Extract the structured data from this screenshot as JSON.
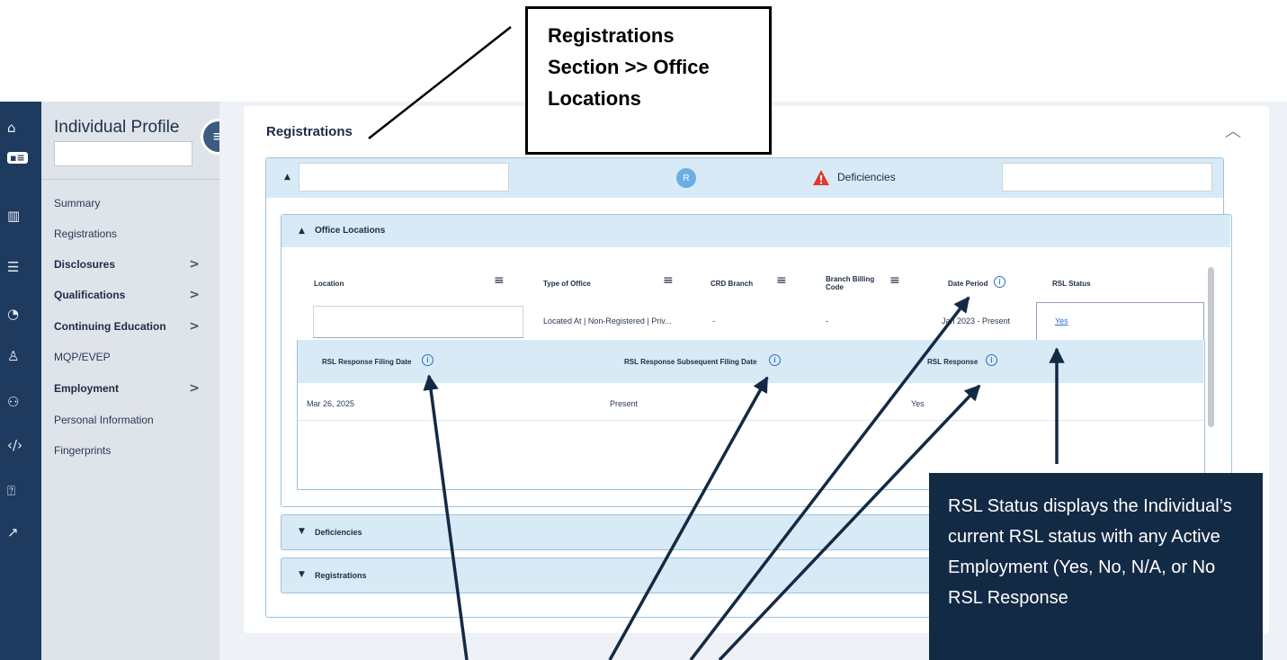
{
  "rail": {
    "icons": [
      "home-icon",
      "profile-card-icon",
      "library-icon",
      "checklist-icon",
      "analytics-icon",
      "user-settings-icon",
      "group-icon",
      "code-icon",
      "help-icon",
      "external-link-icon"
    ]
  },
  "sidenav": {
    "title": "Individual Profile",
    "items": [
      {
        "label": "Summary",
        "bold": false,
        "chevron": ""
      },
      {
        "label": "Registrations",
        "bold": false,
        "chevron": ""
      },
      {
        "label": "Disclosures",
        "bold": true,
        "chevron": ">"
      },
      {
        "label": "Qualifications",
        "bold": true,
        "chevron": ">"
      },
      {
        "label": "Continuing Education",
        "bold": true,
        "chevron": ">"
      },
      {
        "label": "MQP/EVEP",
        "bold": false,
        "chevron": ""
      },
      {
        "label": "Employment",
        "bold": true,
        "chevron": ">"
      },
      {
        "label": "Personal Information",
        "bold": false,
        "chevron": ""
      },
      {
        "label": "Fingerprints",
        "bold": false,
        "chevron": ""
      }
    ]
  },
  "main": {
    "title": "Registrations",
    "header": {
      "badge": "R",
      "deficiencies_label": "Deficiencies"
    },
    "office_locations": {
      "title": "Office Locations",
      "columns": {
        "location": "Location",
        "type_of_office": "Type of Office",
        "crd_branch": "CRD Branch",
        "branch_billing_code_1": "Branch Billing",
        "branch_billing_code_2": "Code",
        "date_period": "Date Period",
        "rsl_status": "RSL Status"
      },
      "row": {
        "type_of_office": "Located At | Non-Registered | Priv...",
        "crd_branch": "-",
        "branch_billing_code": "-",
        "date_period": "Jan 2023 - Present",
        "rsl_status": "Yes"
      },
      "sub_table": {
        "columns": {
          "filing_date": "RSL Response Filing Date",
          "subsequent_filing_date": "RSL Response Subsequent Filing Date",
          "response": "RSL Response"
        },
        "row": {
          "filing_date": "Mar 26, 2025",
          "subsequent_filing_date": "Present",
          "response": "Yes"
        }
      }
    },
    "accordions": {
      "deficiencies": "Deficiencies",
      "registrations": "Registrations"
    }
  },
  "annotations": {
    "top_callout": [
      "Registrations",
      "Section >> Office",
      "Locations"
    ],
    "status_callout": "RSL Status displays the Individual’s current RSL status with any Active Employment (Yes, No, N/A, or No RSL Response"
  },
  "colors": {
    "rail": "#1f3a5f",
    "header_blue": "#d8eaf6",
    "link": "#2a6fc4",
    "callout_dark": "#132a45"
  }
}
